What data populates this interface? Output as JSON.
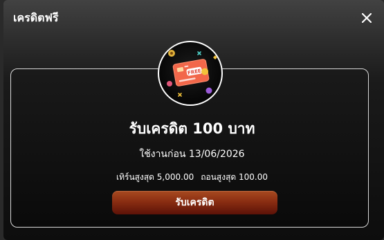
{
  "modal": {
    "title": "เครดิตฟรี",
    "close_icon": "close-icon"
  },
  "promo": {
    "image_icon": "free-credit-card-icon",
    "badge_text": "FREE",
    "title": "รับเครดิต 100 บาท",
    "expiry": "ใช้งานก่อน 13/06/2026",
    "turnover": "เทิร์นสูงสุด 5,000.00",
    "withdraw": "ถอนสูงสุด 100.00",
    "claim_label": "รับเครดิต"
  },
  "colors": {
    "card_orange": "#f2674a",
    "button_top": "#a84a20",
    "button_bottom": "#5c1208"
  }
}
